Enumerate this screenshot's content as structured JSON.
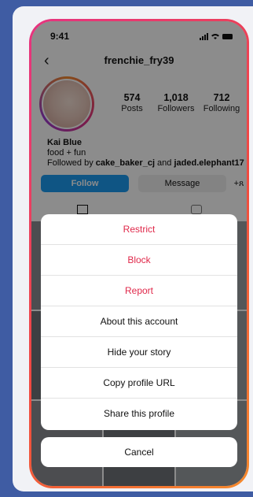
{
  "status": {
    "time": "9:41"
  },
  "profile": {
    "username": "frenchie_fry39",
    "stats": [
      {
        "num": "574",
        "label": "Posts"
      },
      {
        "num": "1,018",
        "label": "Followers"
      },
      {
        "num": "712",
        "label": "Following"
      }
    ],
    "name": "Kai Blue",
    "bio": "food + fun",
    "followed_prefix": "Followed by ",
    "followed_user1": "cake_baker_cj",
    "followed_and": " and ",
    "followed_user2": "jaded.elephant17"
  },
  "buttons": {
    "follow": "Follow",
    "message": "Message",
    "more": "+ጸ"
  },
  "sheet": {
    "options": [
      {
        "label": "Restrict",
        "danger": true
      },
      {
        "label": "Block",
        "danger": true
      },
      {
        "label": "Report",
        "danger": true
      },
      {
        "label": "About this account",
        "danger": false
      },
      {
        "label": "Hide your story",
        "danger": false
      },
      {
        "label": "Copy profile URL",
        "danger": false
      },
      {
        "label": "Share this profile",
        "danger": false
      }
    ],
    "cancel": "Cancel"
  },
  "colors": {
    "background": "#3f5ca3",
    "danger": "#e0284a",
    "follow": "#1d9bf0"
  }
}
